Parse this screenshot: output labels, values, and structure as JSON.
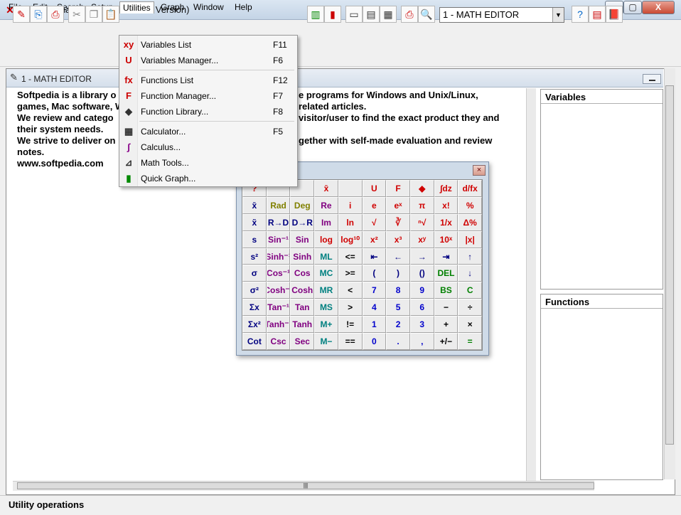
{
  "window": {
    "title": "Math Mechanixs (Pro Evaluation Version)"
  },
  "menubar": [
    "File",
    "Edit",
    "Search",
    "Setup",
    "Utilities",
    "Graph",
    "Window",
    "Help"
  ],
  "toolbar": {
    "editor_selected": "1 - MATH EDITOR"
  },
  "child": {
    "title": "1 - MATH EDITOR"
  },
  "editor_lines": [
    "Softpedia is a library o",
    "games, Mac software, W",
    "We review and catego",
    "their system needs.",
    "We strive to deliver on",
    "notes.",
    "www.softpedia.com"
  ],
  "editor_lines_right": [
    "e programs for Windows and Unix/Linux,",
    "related articles.",
    "visitor/user to find the exact product they and",
    "",
    "gether with self-made evaluation and review",
    "",
    ""
  ],
  "panels": {
    "variables": "Variables",
    "functions": "Functions"
  },
  "utilities_menu": [
    {
      "label": "Variables List",
      "key": "F11",
      "icon": "variables-list-icon",
      "glyph": "xy"
    },
    {
      "label": "Variables Manager...",
      "key": "F6",
      "icon": "variables-manager-icon",
      "glyph": "U"
    },
    {
      "label": "Functions List",
      "key": "F12",
      "icon": "functions-list-icon",
      "glyph": "fx"
    },
    {
      "label": "Function Manager...",
      "key": "F7",
      "icon": "function-manager-icon",
      "glyph": "F"
    },
    {
      "label": "Function Library...",
      "key": "F8",
      "icon": "function-library-icon",
      "glyph": "◆"
    },
    {
      "label": "Calculator...",
      "key": "F5",
      "icon": "calculator-icon",
      "glyph": "▦"
    },
    {
      "label": "Calculus...",
      "key": "",
      "icon": "calculus-icon",
      "glyph": "∫"
    },
    {
      "label": "Math Tools...",
      "key": "",
      "icon": "math-tools-icon",
      "glyph": "⊿"
    },
    {
      "label": "Quick Graph...",
      "key": "",
      "icon": "quick-graph-icon",
      "glyph": "▮"
    }
  ],
  "calculator": {
    "close": "×",
    "keys": [
      [
        "?",
        "",
        "",
        "x̄",
        "",
        "U",
        "F",
        "◆",
        "∫dz",
        "d/fx"
      ],
      [
        "x̄",
        "Rad",
        "Deg",
        "Re",
        "i",
        "e",
        "eˣ",
        "π",
        "x!",
        "%"
      ],
      [
        "x̃",
        "R→D",
        "D→R",
        "Im",
        "ln",
        "√",
        "∛",
        "ⁿ√",
        "1/x",
        "Δ%"
      ],
      [
        "s",
        "Sin⁻¹",
        "Sin",
        "log",
        "log¹⁰",
        "x²",
        "x³",
        "xʸ",
        "10ˣ",
        "|x|"
      ],
      [
        "s²",
        "Sinh⁻¹",
        "Sinh",
        "ML",
        "<=",
        "⇤",
        "←",
        "→",
        "⇥",
        "↑"
      ],
      [
        "σ",
        "Cos⁻¹",
        "Cos",
        "MC",
        ">=",
        "(",
        ")",
        "()",
        "DEL",
        "↓"
      ],
      [
        "σ²",
        "Cosh⁻¹",
        "Cosh",
        "MR",
        "<",
        "7",
        "8",
        "9",
        "BS",
        "C"
      ],
      [
        "Σx",
        "Tan⁻¹",
        "Tan",
        "MS",
        ">",
        "4",
        "5",
        "6",
        "−",
        "÷"
      ],
      [
        "Σx²",
        "Tanh⁻¹",
        "Tanh",
        "M+",
        "!=",
        "1",
        "2",
        "3",
        "+",
        "×"
      ],
      [
        "Cot",
        "Csc",
        "Sec",
        "M−",
        "==",
        "0",
        ".",
        ",",
        "+/−",
        "="
      ]
    ]
  },
  "statusbar": {
    "text": "Utility operations"
  },
  "colors": {
    "key_red": "#d00000",
    "key_purple": "#800080",
    "key_blue": "#0000cc",
    "key_teal": "#008080",
    "key_green": "#008000",
    "key_olive": "#808000",
    "key_black": "#000000",
    "key_navy": "#000080"
  }
}
